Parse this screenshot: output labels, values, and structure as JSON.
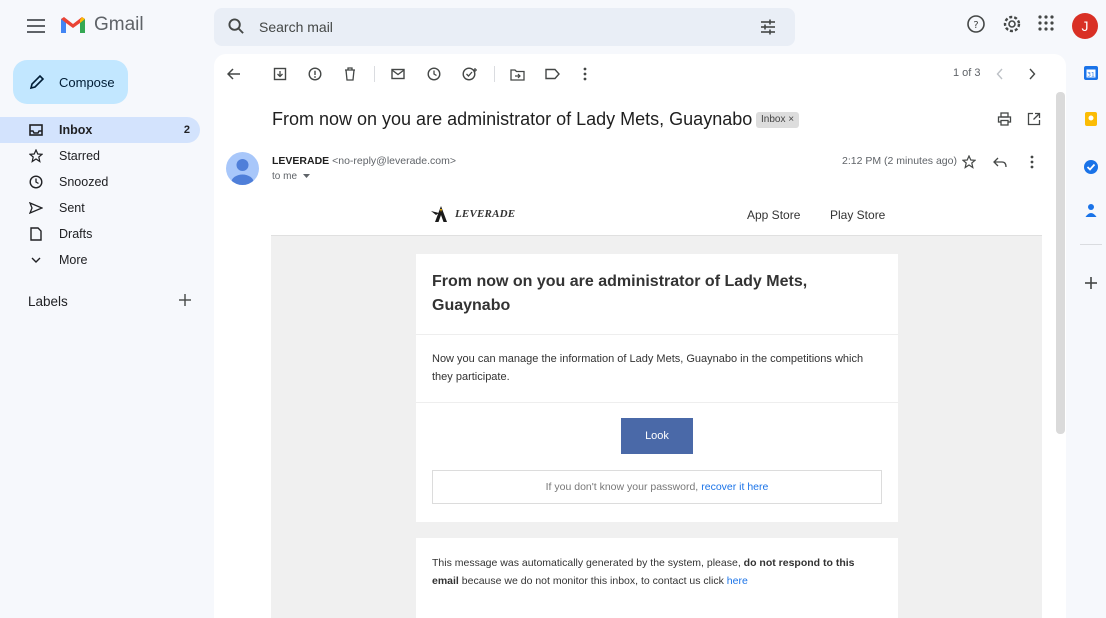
{
  "app": {
    "name": "Gmail"
  },
  "search": {
    "placeholder": "Search mail"
  },
  "account": {
    "initial": "J"
  },
  "sidebar": {
    "compose_label": "Compose",
    "items": [
      {
        "label": "Inbox",
        "count": "2"
      },
      {
        "label": "Starred",
        "count": ""
      },
      {
        "label": "Snoozed",
        "count": ""
      },
      {
        "label": "Sent",
        "count": ""
      },
      {
        "label": "Drafts",
        "count": ""
      },
      {
        "label": "More",
        "count": ""
      }
    ],
    "labels_heading": "Labels"
  },
  "toolbar": {
    "page_count": "1 of 3"
  },
  "message": {
    "subject": "From now on you are administrator of Lady Mets, Guaynabo",
    "chip": "Inbox ×",
    "sender_name": "LEVERADE",
    "sender_email": "<no-reply@leverade.com>",
    "to": "to me",
    "time": "2:12 PM (2 minutes ago)"
  },
  "email": {
    "brand": "LEVERADE",
    "app_store": "App Store",
    "play_store": "Play Store",
    "title": "From now on you are administrator of Lady Mets, Guaynabo",
    "body": "Now you can manage the information of Lady Mets, Guaynabo in the competitions which they participate.",
    "button": "Look",
    "password_text": "If you don't know your password,",
    "password_link": "recover it here",
    "footer_pre": "This message was automatically generated by the system, please,",
    "footer_bold": "do not respond to this email",
    "footer_mid": "because we do not monitor this inbox, to contact us click",
    "footer_link": "here"
  },
  "colors": {
    "accent": "#0b57d0",
    "compose_bg": "#c2e7ff",
    "active_bg": "#d3e3fd",
    "button": "#4a69a8",
    "avatar": "#d93025"
  }
}
